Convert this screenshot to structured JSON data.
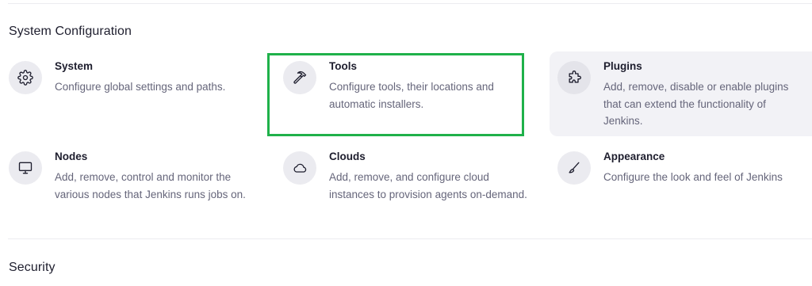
{
  "sections": {
    "system_configuration": "System Configuration",
    "security": "Security"
  },
  "cards": {
    "system": {
      "title": "System",
      "description": "Configure global settings and paths.",
      "icon": "gear-icon"
    },
    "tools": {
      "title": "Tools",
      "description": "Configure tools, their locations and automatic installers.",
      "icon": "hammer-icon"
    },
    "plugins": {
      "title": "Plugins",
      "description": "Add, remove, disable or enable plugins that can extend the functionality of Jenkins.",
      "icon": "puzzle-icon"
    },
    "nodes": {
      "title": "Nodes",
      "description": "Add, remove, control and monitor the various nodes that Jenkins runs jobs on.",
      "icon": "monitor-icon"
    },
    "clouds": {
      "title": "Clouds",
      "description": "Add, remove, and configure cloud instances to provision agents on-demand.",
      "icon": "cloud-icon"
    },
    "appearance": {
      "title": "Appearance",
      "description": "Configure the look and feel of Jenkins",
      "icon": "brush-icon"
    }
  },
  "colors": {
    "highlight": "#1fb14a",
    "hover_background": "#f2f2f6",
    "icon_background": "#ebebf0"
  }
}
